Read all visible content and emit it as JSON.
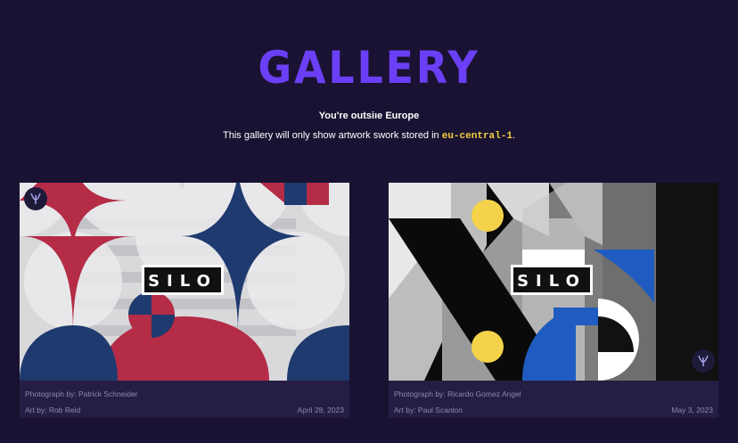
{
  "header": {
    "title": "GALLERY",
    "notice": "You're outsiıe Europe",
    "description_prefix": "This gallery will only show artwork swork stored in",
    "region": "eu-central-1",
    "description_suffix": "."
  },
  "cards": [
    {
      "badge_text": "SILO",
      "photo_credit": "Photograph by: Patrick Schneider",
      "art_credit": "Art by: Rob Reid",
      "date": "April 28, 2023",
      "palette": {
        "red": "#b52c47",
        "blue": "#1e3a6e"
      }
    },
    {
      "badge_text": "SILO",
      "photo_credit": "Photograph by: Ricardo Gomez Angel",
      "art_credit": "Art by: Paul Scanlon",
      "date": "May 3, 2023",
      "palette": {
        "yellow": "#f4d34a",
        "blue": "#1f5bc0"
      }
    }
  ],
  "colors": {
    "background": "#1a1232",
    "accent": "#6b3ff5",
    "region_highlight": "#f4d03f"
  }
}
